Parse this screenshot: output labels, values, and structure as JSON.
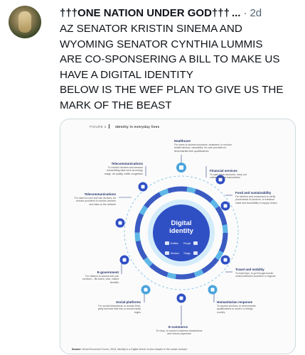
{
  "tweet": {
    "author_name": "†††ONE NATION UNDER GOD†††",
    "more_label": "...",
    "separator": "·",
    "time": "2d",
    "lines": [
      "AZ SENATOR KRISTIN SINEMA AND",
      "WYOMING SENATOR CYNTHIA LUMMIS",
      "ARE CO-SPONSERING A BILL TO MAKE US",
      "HAVE A DIGITAL IDENTITY",
      "BELOW IS THE WEF PLAN TO GIVE US THE",
      "MARK OF THE BEAST"
    ]
  },
  "figure": {
    "label": "FIGURE 2",
    "title": "Identity in everyday lives",
    "center_title_1": "Digital",
    "center_title_2": "identity",
    "center_items": [
      "Entities",
      "People",
      "Devices",
      "Things"
    ],
    "segments": [
      {
        "label": "Healthcare",
        "desc": "For users to access insurance, treatment, to monitor health devices, wearables; for care providers to demonstrate their qualifications"
      },
      {
        "label": "Financial services",
        "desc": "To open bank accounts, carry out online financial transactions"
      },
      {
        "label": "Food and sustainability",
        "desc": "For farmers and consumers to verify provenance of produce, to enhance value and traceability in supply chains"
      },
      {
        "label": "Travel and mobility",
        "desc": "To book trips, to go through border control between countries or regions"
      },
      {
        "label": "Humanitarian response",
        "desc": "To access services, to demonstrate qualifications to work in a foreign country"
      },
      {
        "label": "E-commerce",
        "desc": "To shop, to conduct business transactions and secure payments"
      },
      {
        "label": "Social platforms",
        "desc": "For social interactions; to access third-party services that rely on social media logins"
      },
      {
        "label": "E-government",
        "desc": "For citizens to access and use services – file taxes, vote, collect benefits"
      },
      {
        "label": "Telecommunications",
        "desc": "For users to own and use devices; for service providers to monitor devices and data on the network"
      },
      {
        "label": "Telecommunications",
        "desc": "To monitor devices and sensors transmitting data such as energy usage, air quality, traffic congestion"
      }
    ],
    "source_label": "Source:",
    "source_text": "World Economic Forum, 2018, Identity in a Digital World: A new chapter in the social contract."
  }
}
